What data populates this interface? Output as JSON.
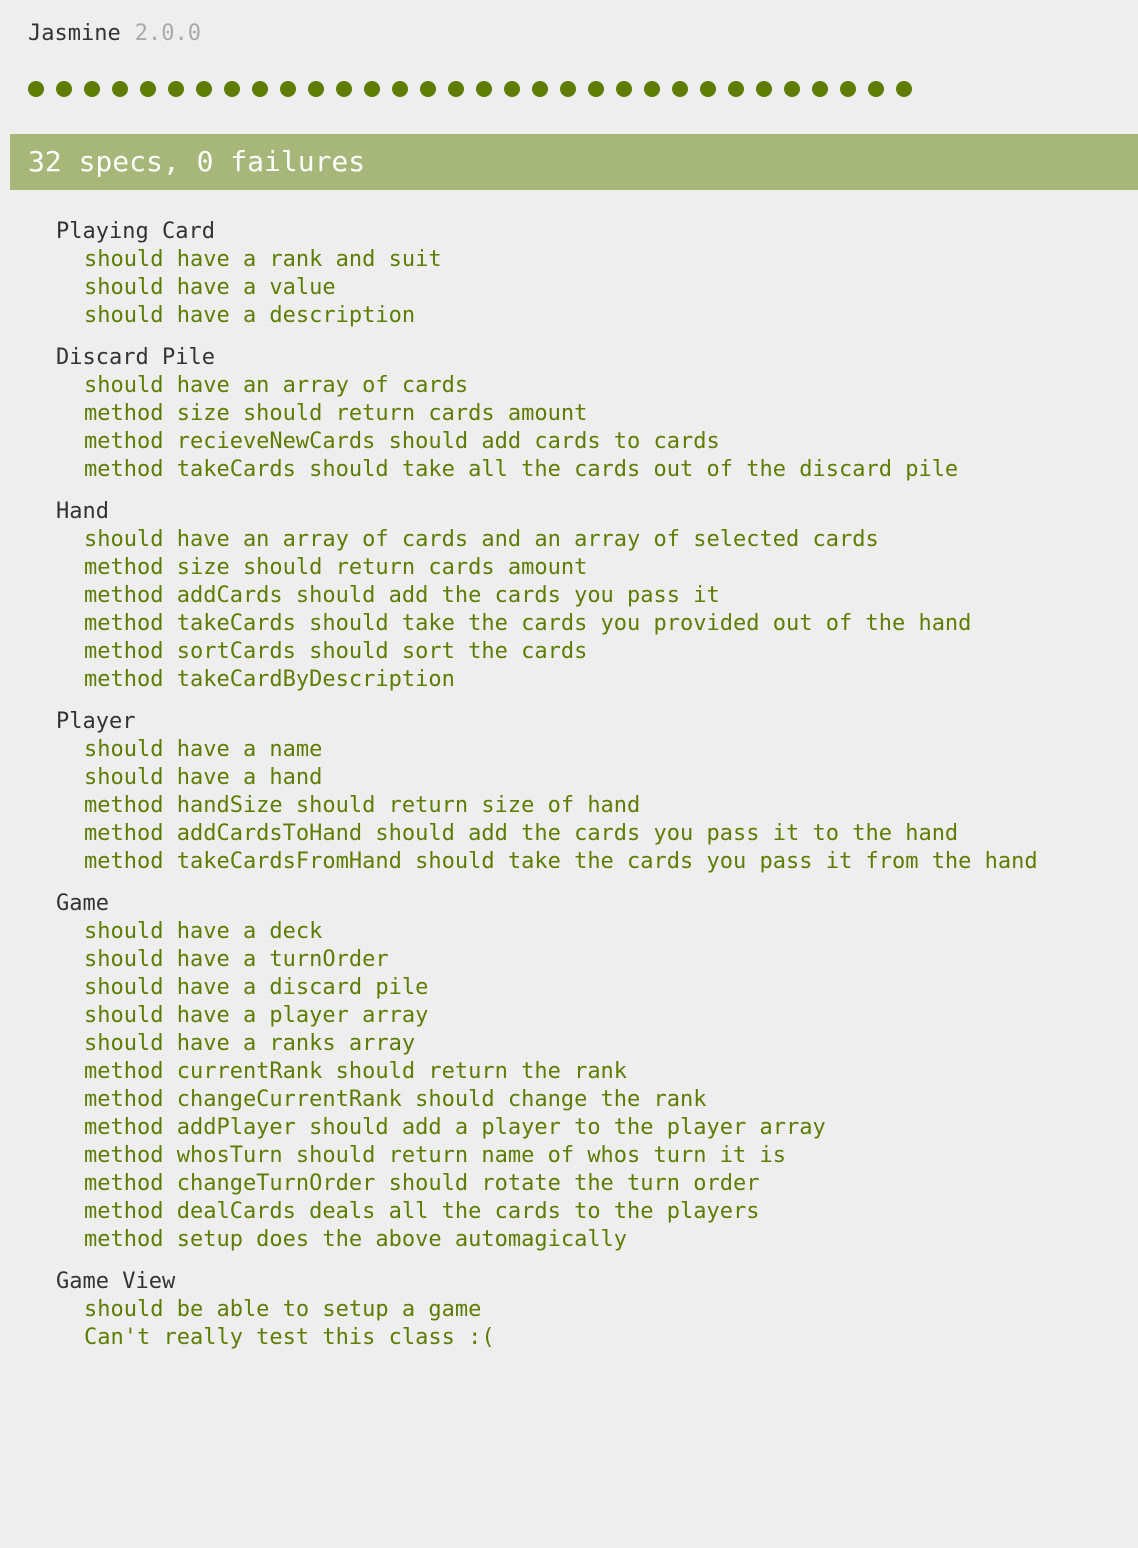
{
  "header": {
    "title": "Jasmine",
    "version": "2.0.0"
  },
  "spec_dots": {
    "count": 32,
    "status": "passed"
  },
  "summary": {
    "text": "32 specs, 0 failures"
  },
  "colors": {
    "pass": "#5e7d00",
    "bar": "#a6b779",
    "bar_text": "#ffffff",
    "background": "#eeeeee",
    "suite_text": "#333333",
    "version_text": "#aaaaaa"
  },
  "suites": [
    {
      "name": "Playing Card",
      "specs": [
        "should have a rank and suit",
        "should have a value",
        "should have a description"
      ]
    },
    {
      "name": "Discard Pile",
      "specs": [
        "should have an array of cards",
        "method size should return cards amount",
        "method recieveNewCards should add cards to cards",
        "method takeCards should take all the cards out of the discard pile"
      ]
    },
    {
      "name": "Hand",
      "specs": [
        "should have an array of cards and an array of selected cards",
        "method size should return cards amount",
        "method addCards should add the cards you pass it",
        "method takeCards should take the cards you provided out of the hand",
        "method sortCards should sort the cards",
        "method takeCardByDescription"
      ]
    },
    {
      "name": "Player",
      "specs": [
        "should have a name",
        "should have a hand",
        "method handSize should return size of hand",
        "method addCardsToHand should add the cards you pass it to the hand",
        "method takeCardsFromHand should take the cards you pass it from the hand"
      ]
    },
    {
      "name": "Game",
      "specs": [
        "should have a deck",
        "should have a turnOrder",
        "should have a discard pile",
        "should have a player array",
        "should have a ranks array",
        "method currentRank should return the rank",
        "method changeCurrentRank should change the rank",
        "method addPlayer should add a player to the player array",
        "method whosTurn should return name of whos turn it is",
        "method changeTurnOrder should rotate the turn order",
        "method dealCards deals all the cards to the players",
        "method setup does the above automagically"
      ]
    },
    {
      "name": "Game View",
      "specs": [
        "should be able to setup a game",
        "Can't really test this class :("
      ]
    }
  ]
}
